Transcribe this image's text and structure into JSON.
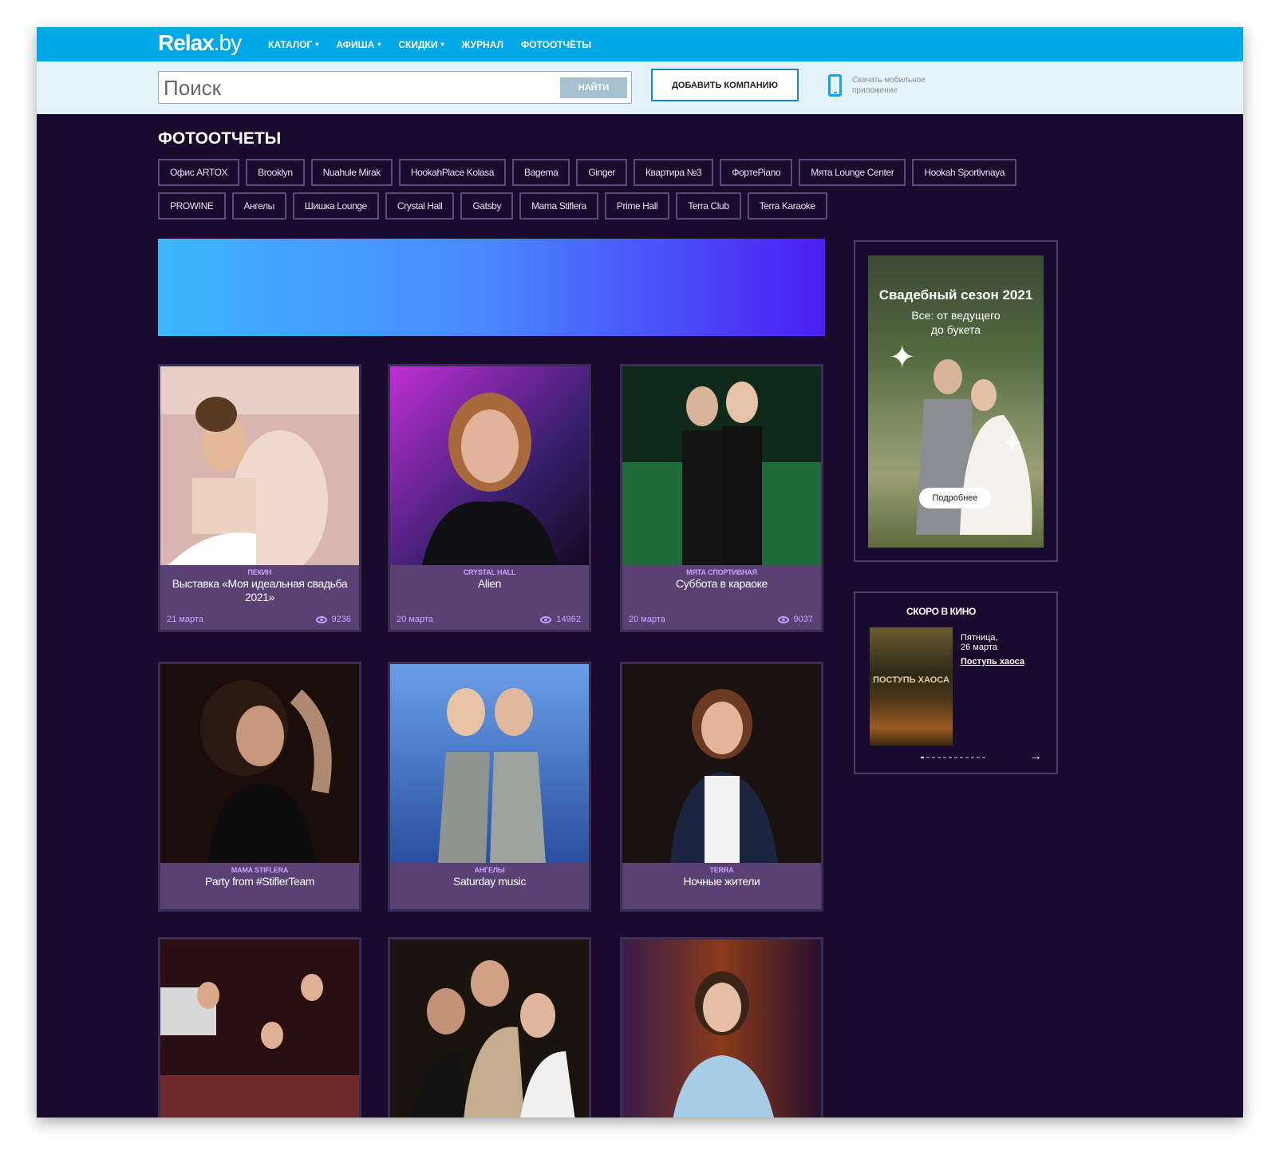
{
  "header": {
    "logo_main": "Relax",
    "logo_suffix": ".by",
    "nav": [
      {
        "label": "КАТАЛОГ",
        "dropdown": true
      },
      {
        "label": "АФИША",
        "dropdown": true
      },
      {
        "label": "СКИДКИ",
        "dropdown": true
      },
      {
        "label": "ЖУРНАЛ",
        "dropdown": false
      },
      {
        "label": "ФОТООТЧЁТЫ",
        "dropdown": false
      }
    ]
  },
  "search": {
    "placeholder": "Поиск",
    "button": "НАЙТИ",
    "add_company": "ДОБАВИТЬ КОМПАНИЮ",
    "app_text": "Скачать мобильное приложение"
  },
  "page": {
    "title": "ФОТООТЧЕТЫ",
    "tags": [
      "Офис ARTOX",
      "Brooklyn",
      "Nuahule Mirak",
      "HookahPlace Kolasa",
      "Bagema",
      "Ginger",
      "Квартира №3",
      "ФортеPiano",
      "Мята Lounge Center",
      "Hookah Sportivnaya",
      "PROWINE",
      "Ангелы",
      "Шишка Lounge",
      "Crystal Hall",
      "Gatsby",
      "Mama Stiflera",
      "Prime Hall",
      "Terra Club",
      "Terra Karaoke"
    ]
  },
  "cards": [
    {
      "venue": "ПЕКИН",
      "title": "Выставка «Моя идеальная свадьба 2021»",
      "date": "21 марта",
      "views": "9236"
    },
    {
      "venue": "CRYSTAL HALL",
      "title": "Alien",
      "date": "20 марта",
      "views": "14962"
    },
    {
      "venue": "МЯТА СПОРТИВНАЯ",
      "title": "Суббота в караоке",
      "date": "20 марта",
      "views": "9037"
    },
    {
      "venue": "MAMA STIFLERA",
      "title": "Party from #StiflerTeam",
      "date": "",
      "views": ""
    },
    {
      "venue": "АНГЕЛЫ",
      "title": "Saturday music",
      "date": "",
      "views": ""
    },
    {
      "venue": "TERRA",
      "title": "Ночные жители",
      "date": "",
      "views": ""
    }
  ],
  "ad": {
    "title": "Свадебный сезон 2021",
    "subtitle_1": "Все: от ведущего",
    "subtitle_2": "до букета",
    "button": "Подробнее"
  },
  "cinema": {
    "title": "СКОРО В КИНО",
    "date_1": "Пятница,",
    "date_2": "26 марта",
    "film": "Поступь хаоса",
    "poster_text": "ПОСТУПЬ ХАОСА"
  }
}
